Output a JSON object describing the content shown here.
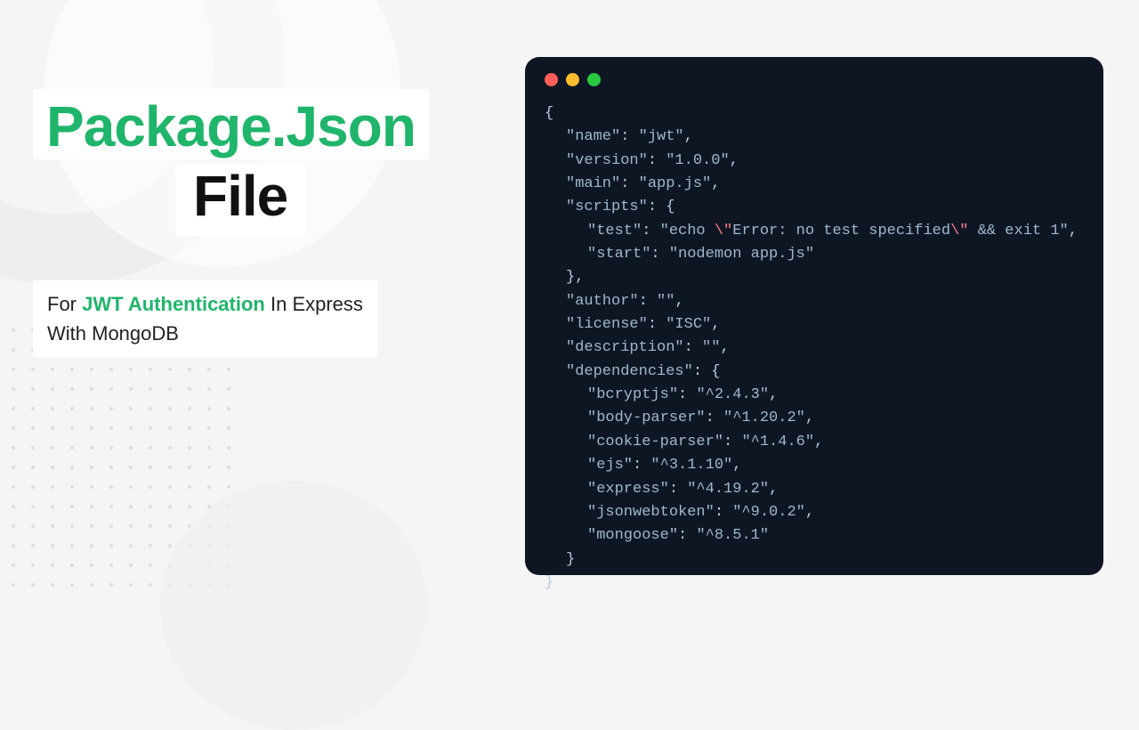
{
  "heading": {
    "line1": "Package.Json",
    "line2": "File"
  },
  "subtitle": {
    "prefix": "For",
    "accent": "JWT Authentication",
    "mid": "In Express",
    "suffix": "With MongoDB"
  },
  "code": {
    "name_key": "\"name\"",
    "name_val": "\"jwt\"",
    "version_key": "\"version\"",
    "version_val": "\"1.0.0\"",
    "main_key": "\"main\"",
    "main_val": "\"app.js\"",
    "scripts_key": "\"scripts\"",
    "test_key": "\"test\"",
    "test_val_open": "\"echo ",
    "test_esc1": "\\\"",
    "test_mid": "Error: no test specified",
    "test_esc2": "\\\"",
    "test_val_close": " && exit 1\"",
    "start_key": "\"start\"",
    "start_val": "\"nodemon app.js\"",
    "author_key": "\"author\"",
    "author_val": "\"\"",
    "license_key": "\"license\"",
    "license_val": "\"ISC\"",
    "description_key": "\"description\"",
    "description_val": "\"\"",
    "deps_key": "\"dependencies\"",
    "dep1_key": "\"bcryptjs\"",
    "dep1_val": "\"^2.4.3\"",
    "dep2_key": "\"body-parser\"",
    "dep2_val": "\"^1.20.2\"",
    "dep3_key": "\"cookie-parser\"",
    "dep3_val": "\"^1.4.6\"",
    "dep4_key": "\"ejs\"",
    "dep4_val": "\"^3.1.10\"",
    "dep5_key": "\"express\"",
    "dep5_val": "\"^4.19.2\"",
    "dep6_key": "\"jsonwebtoken\"",
    "dep6_val": "\"^9.0.2\"",
    "dep7_key": "\"mongoose\"",
    "dep7_val": "\"^8.5.1\""
  }
}
